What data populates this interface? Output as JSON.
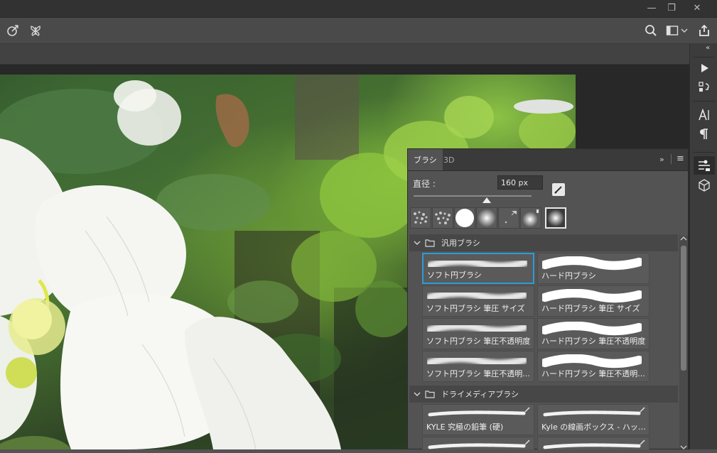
{
  "window": {
    "minimize_glyph": "—",
    "restore_glyph": "❐",
    "close_glyph": "✕"
  },
  "options_bar": {
    "left_icons": [
      "select-subject-icon",
      "butterfly-icon"
    ],
    "right_icons": [
      "search-icon",
      "workspace-icon",
      "chevron-down-icon",
      "share-icon"
    ]
  },
  "right_strip": {
    "collapse_glyph": "«",
    "buttons": [
      "play-icon",
      "history-icon",
      "character-icon",
      "paragraph-icon",
      "brush-settings-icon",
      "3d-cube-icon"
    ]
  },
  "brush_panel": {
    "tabs": [
      {
        "label": "ブラシ",
        "active": true
      },
      {
        "label": "3D",
        "active": false
      }
    ],
    "expand_glyph": "»",
    "menu_glyph": "≡",
    "size_label": "直径 :",
    "size_value": "160 px",
    "slider_fraction": 0.62,
    "groups": [
      {
        "name": "汎用ブラシ",
        "items": [
          {
            "label": "ソフト円ブラシ",
            "kind": "soft",
            "selected": true
          },
          {
            "label": "ハード円ブラシ",
            "kind": "hard",
            "selected": false
          },
          {
            "label": "ソフト円ブラシ 筆圧 サイズ",
            "kind": "soft",
            "selected": false
          },
          {
            "label": "ハード円ブラシ 筆圧 サイズ",
            "kind": "hard",
            "selected": false
          },
          {
            "label": "ソフト円ブラシ 筆圧不透明度",
            "kind": "soft",
            "selected": false
          },
          {
            "label": "ハード円ブラシ 筆圧不透明度",
            "kind": "hard",
            "selected": false
          },
          {
            "label": "ソフト円ブラシ 筆圧不透明...",
            "kind": "soft",
            "selected": false
          },
          {
            "label": "ハード円ブラシ 筆圧不透明...",
            "kind": "hard",
            "selected": false
          }
        ]
      },
      {
        "name": "ドライメディアブラシ",
        "items": [
          {
            "label": "KYLE 究極の鉛筆 (硬)",
            "kind": "dry",
            "selected": false
          },
          {
            "label": "Kyle の線画ボックス - ハッピ...",
            "kind": "dry",
            "selected": false
          },
          {
            "label": "",
            "kind": "dry",
            "selected": false
          },
          {
            "label": "",
            "kind": "dry",
            "selected": false
          }
        ]
      }
    ]
  },
  "colors": {
    "selection_accent": "#2d9bd9",
    "panel_bg": "#535353",
    "app_chrome": "#323232"
  }
}
